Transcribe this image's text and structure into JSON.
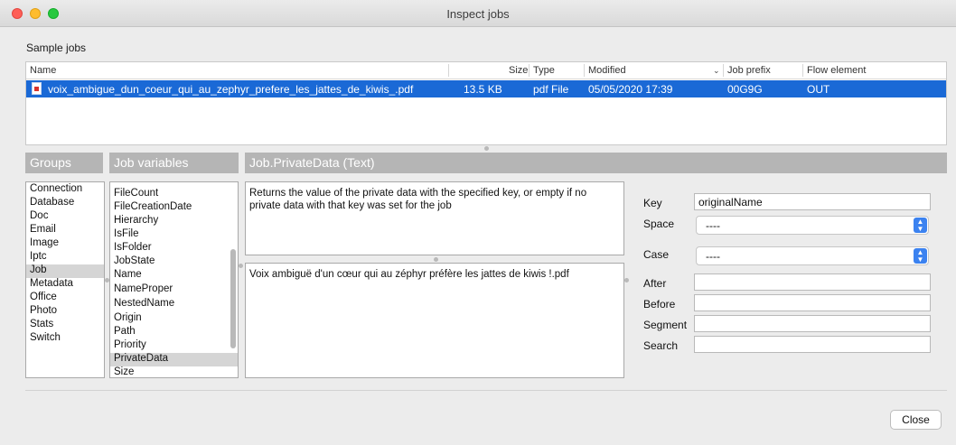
{
  "window": {
    "title": "Inspect jobs"
  },
  "sample_jobs": {
    "label": "Sample jobs",
    "columns": [
      "Name",
      "Size",
      "Type",
      "Modified",
      "Job prefix",
      "Flow element"
    ],
    "rows": [
      {
        "name": "voix_ambigue_dun_coeur_qui_au_zephyr_prefere_les_jattes_de_kiwis_.pdf",
        "size": "13.5 KB",
        "type": "pdf File",
        "modified": "05/05/2020 17:39",
        "job_prefix": "00G9G",
        "flow_element": "OUT"
      }
    ],
    "sort_indicator": "⌄"
  },
  "groups": {
    "title": "Groups",
    "items": [
      "Connection",
      "Database",
      "Doc",
      "Email",
      "Image",
      "Iptc",
      "Job",
      "Metadata",
      "Office",
      "Photo",
      "Stats",
      "Switch"
    ],
    "selected": "Job"
  },
  "job_variables": {
    "title": "Job variables",
    "items": [
      "FileCount",
      "FileCreationDate",
      "Hierarchy",
      "IsFile",
      "IsFolder",
      "JobState",
      "Name",
      "NameProper",
      "NestedName",
      "Origin",
      "Path",
      "Priority",
      "PrivateData",
      "Size"
    ],
    "selected": "PrivateData"
  },
  "detail": {
    "title": "Job.PrivateData (Text)",
    "description": "Returns the value of the private data with the specified key, or empty if no private data with that key was set for the job",
    "result": "Voix ambiguë d'un cœur qui au zéphyr préfère les jattes de kiwis !.pdf"
  },
  "arguments": {
    "key_label": "Key",
    "key_value": "originalName",
    "space_label": "Space",
    "space_value": "----",
    "case_label": "Case",
    "case_value": "----",
    "after_label": "After",
    "after_value": "",
    "before_label": "Before",
    "before_value": "",
    "segment_label": "Segment",
    "segment_value": "",
    "search_label": "Search",
    "search_value": ""
  },
  "footer": {
    "close_label": "Close"
  },
  "colors": {
    "selection": "#1a69d6",
    "panel_header": "#b5b5b5",
    "list_selected": "#d5d5d5"
  }
}
